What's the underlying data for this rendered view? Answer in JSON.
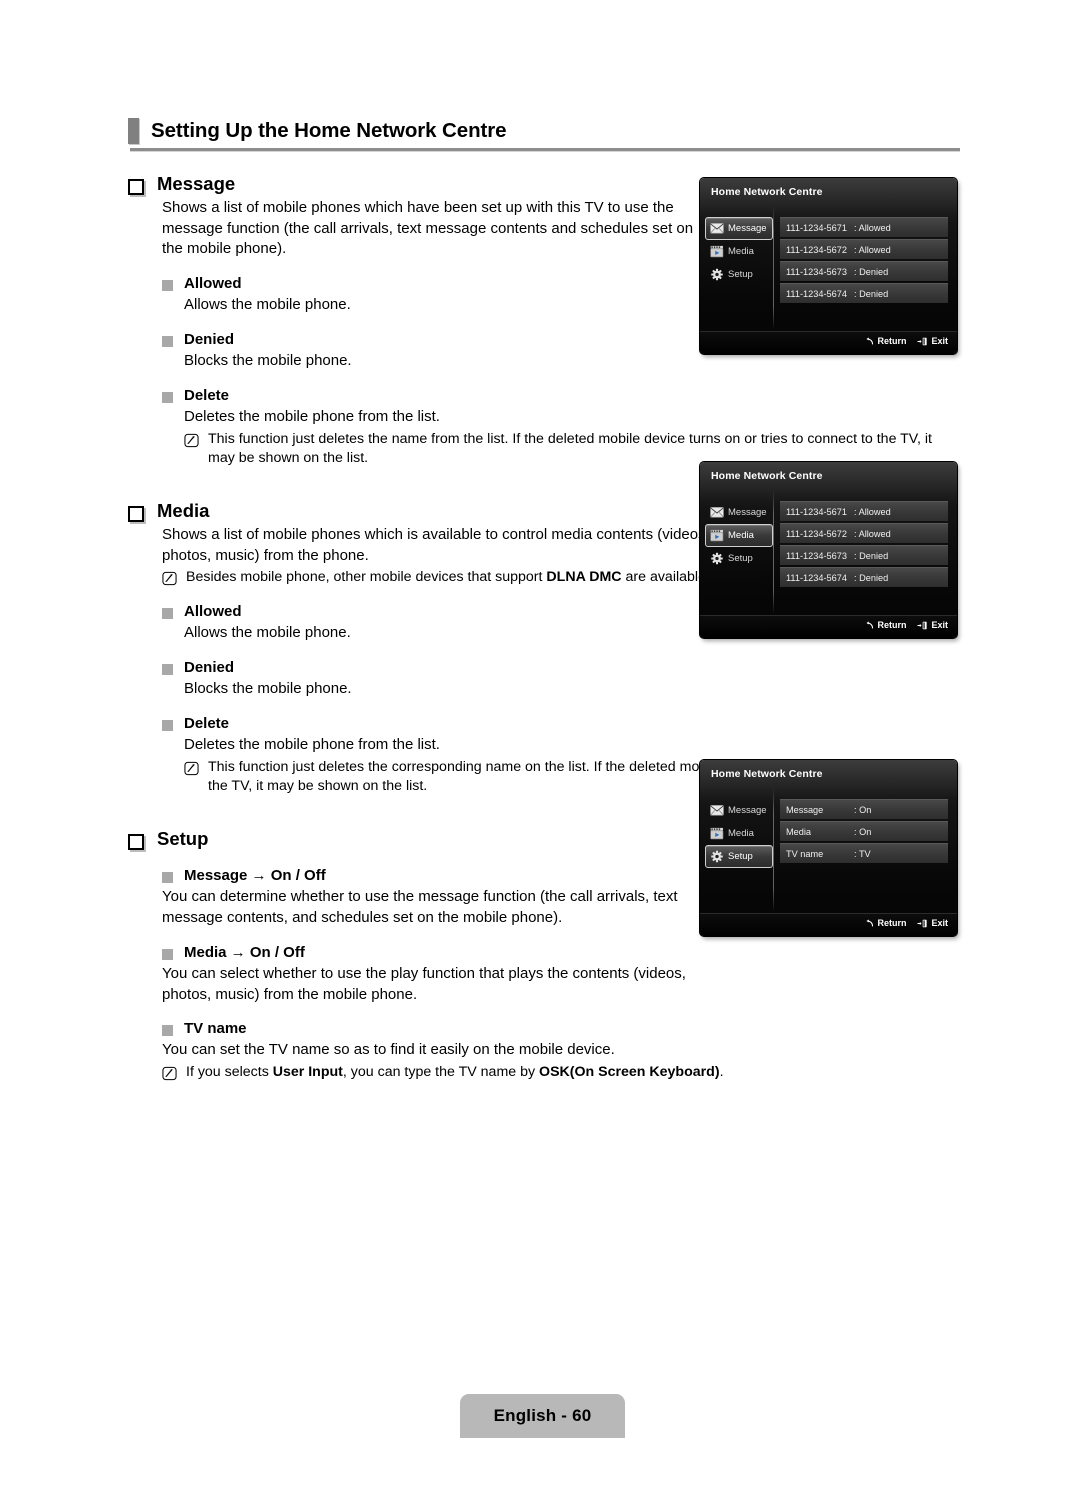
{
  "header": {
    "title": "Setting Up the Home Network Centre"
  },
  "sections": [
    {
      "id": "message",
      "title": "Message",
      "body": "Shows a list of mobile phones which have been set up with this TV to use the message function (the call arrivals, text message contents and schedules set on the mobile phone).",
      "items": [
        {
          "title": "Allowed",
          "body": "Allows the mobile phone."
        },
        {
          "title": "Denied",
          "body": "Blocks the mobile phone."
        },
        {
          "title": "Delete",
          "body": "Deletes the mobile phone from the list.",
          "note": "This function just deletes the name from the list. If the deleted mobile device turns on or tries to connect to the TV, it may be shown on the list."
        }
      ]
    },
    {
      "id": "media",
      "title": "Media",
      "body": "Shows a list of mobile phones which is available to control media contents (videos, photos, music) from the phone.",
      "note_pre": "Besides mobile phone, other mobile devices that support ",
      "note_bold": "DLNA DMC",
      "note_post": " are available.",
      "items": [
        {
          "title": "Allowed",
          "body": "Allows the mobile phone."
        },
        {
          "title": "Denied",
          "body": "Blocks the mobile phone."
        },
        {
          "title": "Delete",
          "body": "Deletes the mobile phone from the list.",
          "note": "This function just deletes the corresponding name on the list. If the deleted mobile device turns on or tries to connect to the TV, it may be shown on the list."
        }
      ]
    },
    {
      "id": "setup",
      "title": "Setup",
      "items": [
        {
          "title": "Message → On / Off",
          "body": "You can determine whether to use the message function (the call arrivals, text message contents, and schedules set on the mobile phone)."
        },
        {
          "title": "Media → On / Off",
          "body": "You can select whether to use the play function that plays the contents (videos, photos, music) from the mobile phone."
        },
        {
          "title": "TV name",
          "body": "You can set the TV name so as to find it easily on the mobile device."
        }
      ],
      "note_pre": "If you selects ",
      "note_bold1": "User Input",
      "note_mid": ", you can type the TV name by ",
      "note_bold2": "OSK(On Screen Keyboard)",
      "note_post": "."
    }
  ],
  "tv_screens": [
    {
      "id": "message-screen",
      "title": "Home Network Centre",
      "active": "Message",
      "sidebar": [
        {
          "label": "Message",
          "icon": "envelope-icon"
        },
        {
          "label": "Media",
          "icon": "media-frame-icon"
        },
        {
          "label": "Setup",
          "icon": "gear-icon"
        }
      ],
      "rows": [
        {
          "key": "111-1234-5671",
          "value": ": Allowed"
        },
        {
          "key": "111-1234-5672",
          "value": ": Allowed"
        },
        {
          "key": "111-1234-5673",
          "value": ": Denied"
        },
        {
          "key": "111-1234-5674",
          "value": ": Denied"
        }
      ],
      "footer": [
        {
          "label": "Return",
          "icon": "return-arrow-icon"
        },
        {
          "label": "Exit",
          "icon": "exit-door-icon"
        }
      ]
    },
    {
      "id": "media-screen",
      "title": "Home Network Centre",
      "active": "Media",
      "sidebar": [
        {
          "label": "Message",
          "icon": "envelope-icon"
        },
        {
          "label": "Media",
          "icon": "media-frame-icon"
        },
        {
          "label": "Setup",
          "icon": "gear-icon"
        }
      ],
      "rows": [
        {
          "key": "111-1234-5671",
          "value": ": Allowed"
        },
        {
          "key": "111-1234-5672",
          "value": ": Allowed"
        },
        {
          "key": "111-1234-5673",
          "value": ": Denied"
        },
        {
          "key": "111-1234-5674",
          "value": ": Denied"
        }
      ],
      "footer": [
        {
          "label": "Return",
          "icon": "return-arrow-icon"
        },
        {
          "label": "Exit",
          "icon": "exit-door-icon"
        }
      ]
    },
    {
      "id": "setup-screen",
      "title": "Home Network Centre",
      "active": "Setup",
      "sidebar": [
        {
          "label": "Message",
          "icon": "envelope-icon"
        },
        {
          "label": "Media",
          "icon": "media-frame-icon"
        },
        {
          "label": "Setup",
          "icon": "gear-icon"
        }
      ],
      "rows": [
        {
          "key": "Message",
          "value": ": On"
        },
        {
          "key": "Media",
          "value": ": On"
        },
        {
          "key": "TV name",
          "value": ": TV"
        }
      ],
      "footer": [
        {
          "label": "Return",
          "icon": "return-arrow-icon"
        },
        {
          "label": "Exit",
          "icon": "exit-door-icon"
        }
      ]
    }
  ],
  "footer": {
    "page_label": "English - 60"
  },
  "colors": {
    "rule": "#8d8d8d",
    "bullet_fill": "#a8a8a8",
    "page_tab": "#b8b8b8",
    "screen_bg": "#0a0a0a"
  }
}
